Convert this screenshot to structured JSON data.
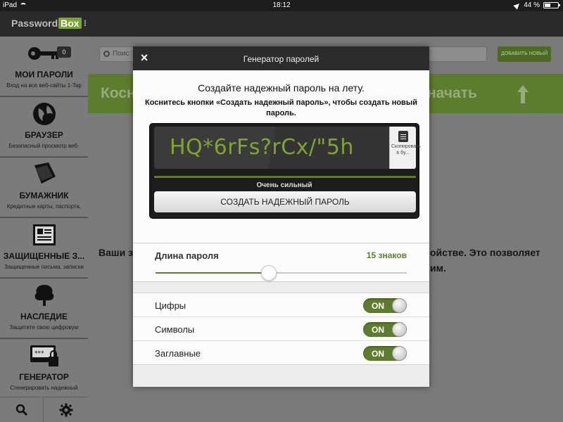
{
  "status": {
    "device": "iPad",
    "time": "18:12",
    "battery": "44 %"
  },
  "header": {
    "logo_main": "Password",
    "logo_box": "Box",
    "logo_dots": "⁝"
  },
  "sidebar": {
    "items": [
      {
        "title": "МОИ ПАРОЛИ",
        "desc": "Вход на все веб-сайты 1-Tap",
        "badge": "0",
        "icon": "key-icon"
      },
      {
        "title": "БРАУЗЕР",
        "desc": "Безопасный просмотр веб-",
        "icon": "globe-icon"
      },
      {
        "title": "БУМАЖНИК",
        "desc": "Кредитные карты, паспорта,",
        "icon": "wallet-icon"
      },
      {
        "title": "ЗАЩИЩЕННЫЕ З...",
        "desc": "Защищенные письма, записки",
        "icon": "document-icon"
      },
      {
        "title": "НАСЛЕДИЕ",
        "desc": "Защитите свою цифровую",
        "icon": "tree-icon"
      },
      {
        "title": "ГЕНЕРАТОР",
        "desc": "Сгенерировать надежный",
        "icon": "password-lock-icon"
      }
    ]
  },
  "main": {
    "search_placeholder": "Поис",
    "add_button": "ДОБАВИТЬ НОВЫЙ",
    "banner_left": "Косн",
    "banner_right": "начать",
    "text_left": "Ваши з",
    "text_right_1": "ойстве.  Это позволяет",
    "text_right_2": "им."
  },
  "modal": {
    "title": "Генератор паролей",
    "close": "×",
    "headline": "Создайте надежный пароль на лету.",
    "subtitle": "Коснитесь кнопки «Создать надежный пароль», чтобы создать новый пароль.",
    "password": "HQ*6rFs?rCx/\"5h",
    "copy_label": "Скопировать в бу...",
    "strength": "Очень сильный",
    "generate_button": "СОЗДАТЬ НАДЕЖНЫЙ ПАРОЛЬ",
    "length_label": "Длина пароля",
    "length_value": "15 знаков",
    "length_fraction": 0.45,
    "options": [
      {
        "label": "Цифры",
        "state": "ON"
      },
      {
        "label": "Символы",
        "state": "ON"
      },
      {
        "label": "Заглавные",
        "state": "ON"
      }
    ]
  },
  "colors": {
    "accent": "#5e7c2e",
    "password_text": "#7fa432"
  }
}
